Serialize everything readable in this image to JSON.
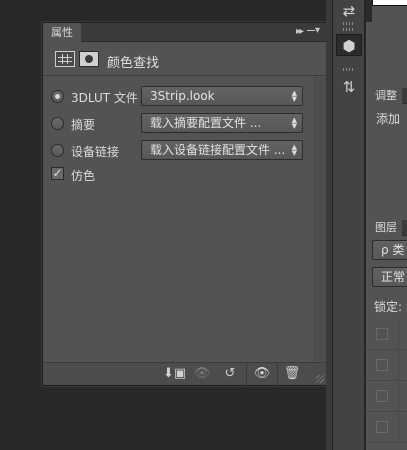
{
  "panel": {
    "tab_label": "属性",
    "collapse_glyph": "▸▸",
    "title": "颜色查找",
    "rows": [
      {
        "label": "3DLUT 文件",
        "value": "3Strip.look",
        "selected": true
      },
      {
        "label": "摘要",
        "value": "载入摘要配置文件 ...",
        "selected": false
      },
      {
        "label": "设备链接",
        "value": "载入设备链接配置文件 ...",
        "selected": false
      }
    ],
    "dither": {
      "label": "仿色",
      "checked": true,
      "mark": "✓"
    },
    "footer_icons": {
      "clip": "⬇▣",
      "view_prev": "👁",
      "reset": "↺",
      "visibility": "👁",
      "delete": "🗑"
    }
  },
  "toolbar": {
    "history_icon": "⇄",
    "adjust_icon": "⬢",
    "actions_icon": "⇅"
  },
  "dock": {
    "adjust_tab": "调整",
    "adjust_text": "添加",
    "layers_tab": "图层",
    "filter_kind": "ρ 类",
    "blend_mode": "正常",
    "lock_label": "锁定:"
  },
  "colors": {
    "panel_bg": "#535353",
    "background": "#282828"
  }
}
